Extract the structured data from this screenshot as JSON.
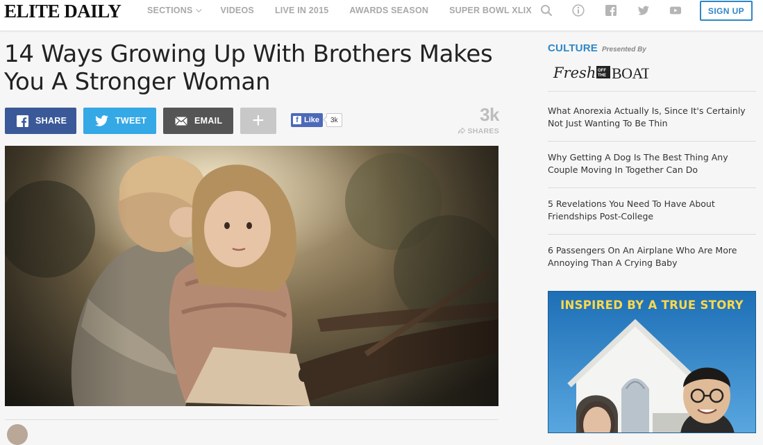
{
  "header": {
    "logo": "ELITE DAILY",
    "nav": [
      {
        "label": "SECTIONS",
        "dropdown": true
      },
      {
        "label": "VIDEOS",
        "dropdown": false
      },
      {
        "label": "LIVE IN 2015",
        "dropdown": false
      },
      {
        "label": "AWARDS SEASON",
        "dropdown": false
      },
      {
        "label": "SUPER BOWL XLIX",
        "dropdown": false
      }
    ],
    "icons": [
      "search-icon",
      "info-icon",
      "facebook-icon",
      "twitter-icon",
      "youtube-icon"
    ],
    "signup_label": "SIGN UP"
  },
  "article": {
    "title": "14 Ways Growing Up With Brothers Makes You A Stronger Woman",
    "share_buttons": {
      "share": "SHARE",
      "tweet": "TWEET",
      "email": "EMAIL",
      "more": "+"
    },
    "fb_like": {
      "label": "Like",
      "count": "3k"
    },
    "share_count": "3k",
    "share_label": "SHARES",
    "hero_image": "two children hugging outdoors"
  },
  "sidebar": {
    "section_label": "CULTURE",
    "presented_by": "Presented By",
    "sponsor": "Fresh off the BOAT",
    "links": [
      "What Anorexia Actually Is, Since It's Certainly Not Just Wanting To Be Thin",
      "Why Getting A Dog Is The Best Thing Any Couple Moving In Together Can Do",
      "5 Revelations You Need To Have About Friendships Post-College",
      "6 Passengers On An Airplane Who Are More Annoying Than A Crying Baby"
    ],
    "ad_title": "INSPIRED BY A TRUE STORY"
  },
  "colors": {
    "accent": "#2d86c8",
    "facebook": "#3b5998",
    "twitter": "#35a8e6",
    "email": "#555555",
    "ad_title": "#ffd94a"
  }
}
